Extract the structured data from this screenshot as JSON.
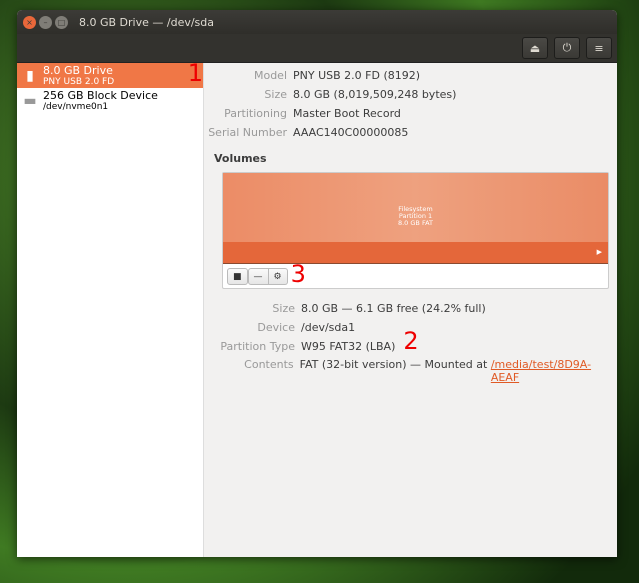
{
  "window": {
    "title": "8.0 GB Drive — /dev/sda"
  },
  "toolbar": {
    "eject": "⏏",
    "power": "⏻",
    "menu": "≡"
  },
  "sidebar": {
    "items": [
      {
        "name": "8.0 GB Drive",
        "sub": "PNY USB 2.0 FD",
        "selected": true
      },
      {
        "name": "256 GB Block Device",
        "sub": "/dev/nvme0n1",
        "selected": false
      }
    ]
  },
  "annotations": [
    "1",
    "2",
    "3"
  ],
  "drive": {
    "model_label": "Model",
    "model": "PNY USB 2.0 FD (8192)",
    "size_label": "Size",
    "size": "8.0 GB (8,019,509,248 bytes)",
    "partitioning_label": "Partitioning",
    "partitioning": "Master Boot Record",
    "serial_label": "Serial Number",
    "serial": "AAAC140C00000085"
  },
  "volumes": {
    "heading": "Volumes",
    "partition": {
      "line1": "Filesystem",
      "line2": "Partition 1",
      "line3": "8.0 GB FAT"
    },
    "size_label": "Size",
    "size": "8.0 GB — 6.1 GB free (24.2% full)",
    "device_label": "Device",
    "device": "/dev/sda1",
    "ptype_label": "Partition Type",
    "ptype": "W95 FAT32 (LBA)",
    "contents_label": "Contents",
    "contents": "FAT (32-bit version) — Mounted at ",
    "mount": "/media/test/8D9A-AEAF"
  }
}
